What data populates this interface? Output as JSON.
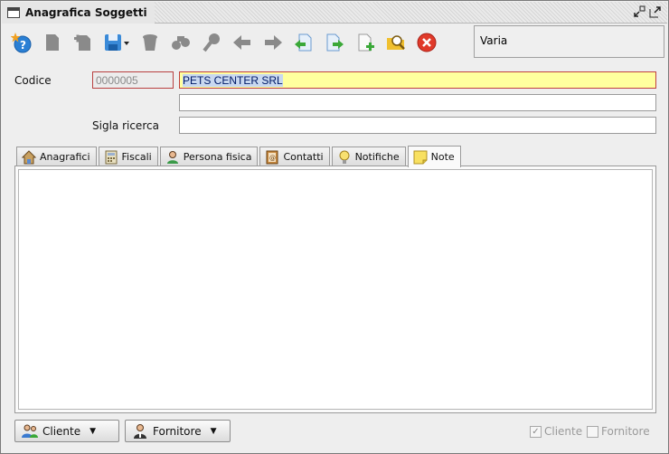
{
  "window": {
    "title": "Anagrafica Soggetti"
  },
  "toolbar": {
    "buttons": [
      {
        "icon": "new-star-icon"
      },
      {
        "icon": "document-icon"
      },
      {
        "icon": "document-add-icon"
      },
      {
        "icon": "save-icon"
      },
      {
        "icon": "trash-icon"
      },
      {
        "icon": "binoculars-icon"
      },
      {
        "icon": "key-icon"
      },
      {
        "icon": "arrow-left-icon"
      },
      {
        "icon": "arrow-right-icon"
      },
      {
        "icon": "import-icon"
      },
      {
        "icon": "export-icon"
      },
      {
        "icon": "add-page-icon"
      },
      {
        "icon": "search-folder-icon"
      },
      {
        "icon": "close-icon"
      }
    ],
    "varia_label": "Varia"
  },
  "form": {
    "codice_label": "Codice",
    "codice_value": "0000005",
    "name_value": "PETS CENTER SRL",
    "line2_value": "",
    "sigla_label": "Sigla ricerca",
    "sigla_value": ""
  },
  "tabs": [
    {
      "label": "Anagrafici",
      "icon": "house-icon"
    },
    {
      "label": "Fiscali",
      "icon": "calculator-icon"
    },
    {
      "label": "Persona fisica",
      "icon": "person-icon"
    },
    {
      "label": "Contatti",
      "icon": "contact-book-icon"
    },
    {
      "label": "Notifiche",
      "icon": "lightbulb-icon"
    },
    {
      "label": "Note",
      "icon": "note-icon",
      "active": true
    }
  ],
  "bottom": {
    "cliente_button": "Cliente",
    "fornitore_button": "Fornitore",
    "cliente_check_label": "Cliente",
    "cliente_checked": true,
    "fornitore_check_label": "Fornitore",
    "fornitore_checked": false
  },
  "colors": {
    "required_field_bg": "#ffff9e",
    "required_border": "#c04040",
    "accent_blue": "#2a7fd4",
    "close_red": "#e03a2a"
  }
}
